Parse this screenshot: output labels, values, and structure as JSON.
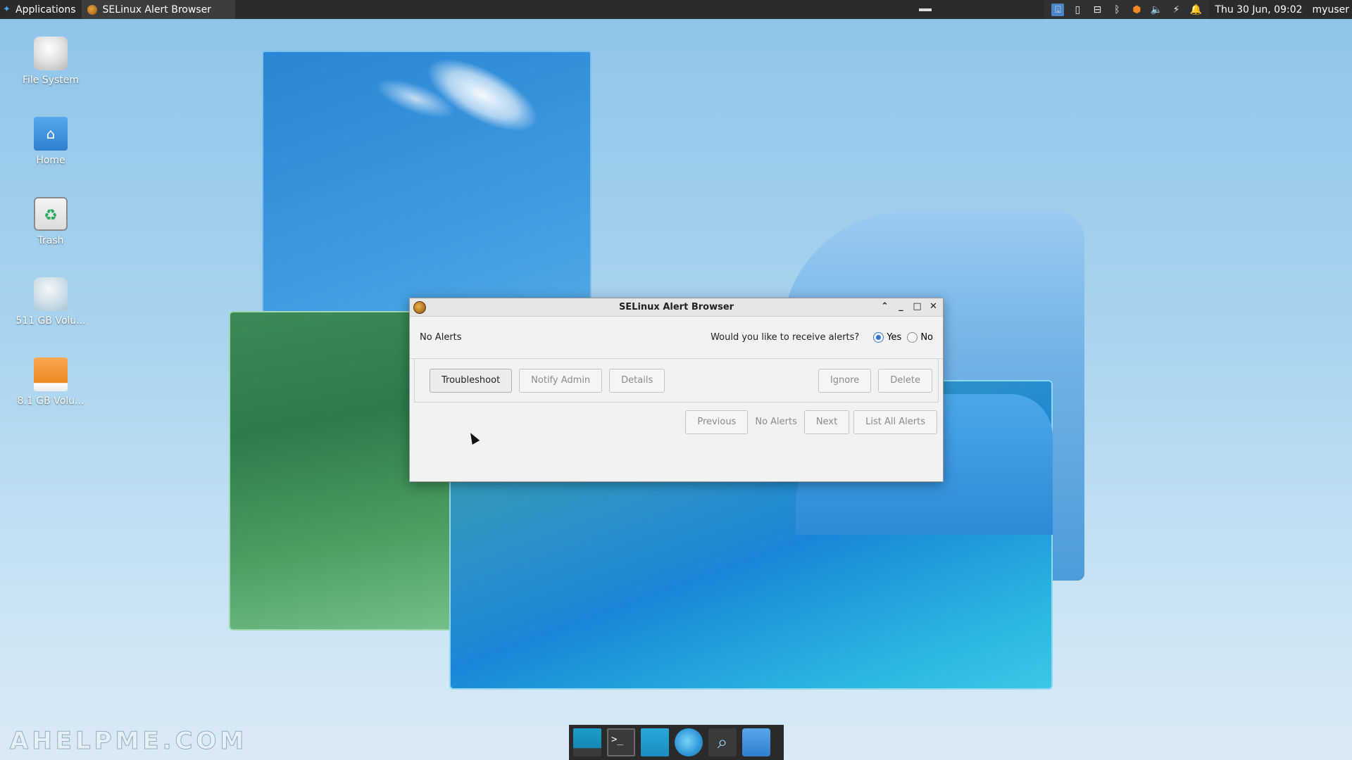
{
  "top_panel": {
    "applications_label": "Applications",
    "task_title": "SELinux Alert Browser",
    "clock": "Thu 30 Jun, 09:02",
    "user": "myuser"
  },
  "desktop_icons": [
    {
      "label": "File System",
      "icon": "drive-harddisk-icon"
    },
    {
      "label": "Home",
      "icon": "home-folder-icon"
    },
    {
      "label": "Trash",
      "icon": "trash-icon"
    },
    {
      "label": "511 GB Volu...",
      "icon": "drive-volume-icon"
    },
    {
      "label": "8.1 GB Volu...",
      "icon": "drive-removable-icon"
    }
  ],
  "dialog": {
    "title": "SELinux Alert Browser",
    "status": "No Alerts",
    "question": "Would you like to receive alerts?",
    "radio_yes": "Yes",
    "radio_no": "No",
    "selected": "Yes",
    "actions": {
      "troubleshoot": "Troubleshoot",
      "notify_admin": "Notify Admin",
      "details": "Details",
      "ignore": "Ignore",
      "delete": "Delete"
    },
    "nav": {
      "previous": "Previous",
      "position": "No Alerts",
      "next": "Next",
      "list_all": "List All Alerts"
    }
  },
  "watermark": "AHELPME.COM",
  "colors": {
    "panel_bg": "#2b2b2b",
    "accent": "#2a76d2"
  }
}
